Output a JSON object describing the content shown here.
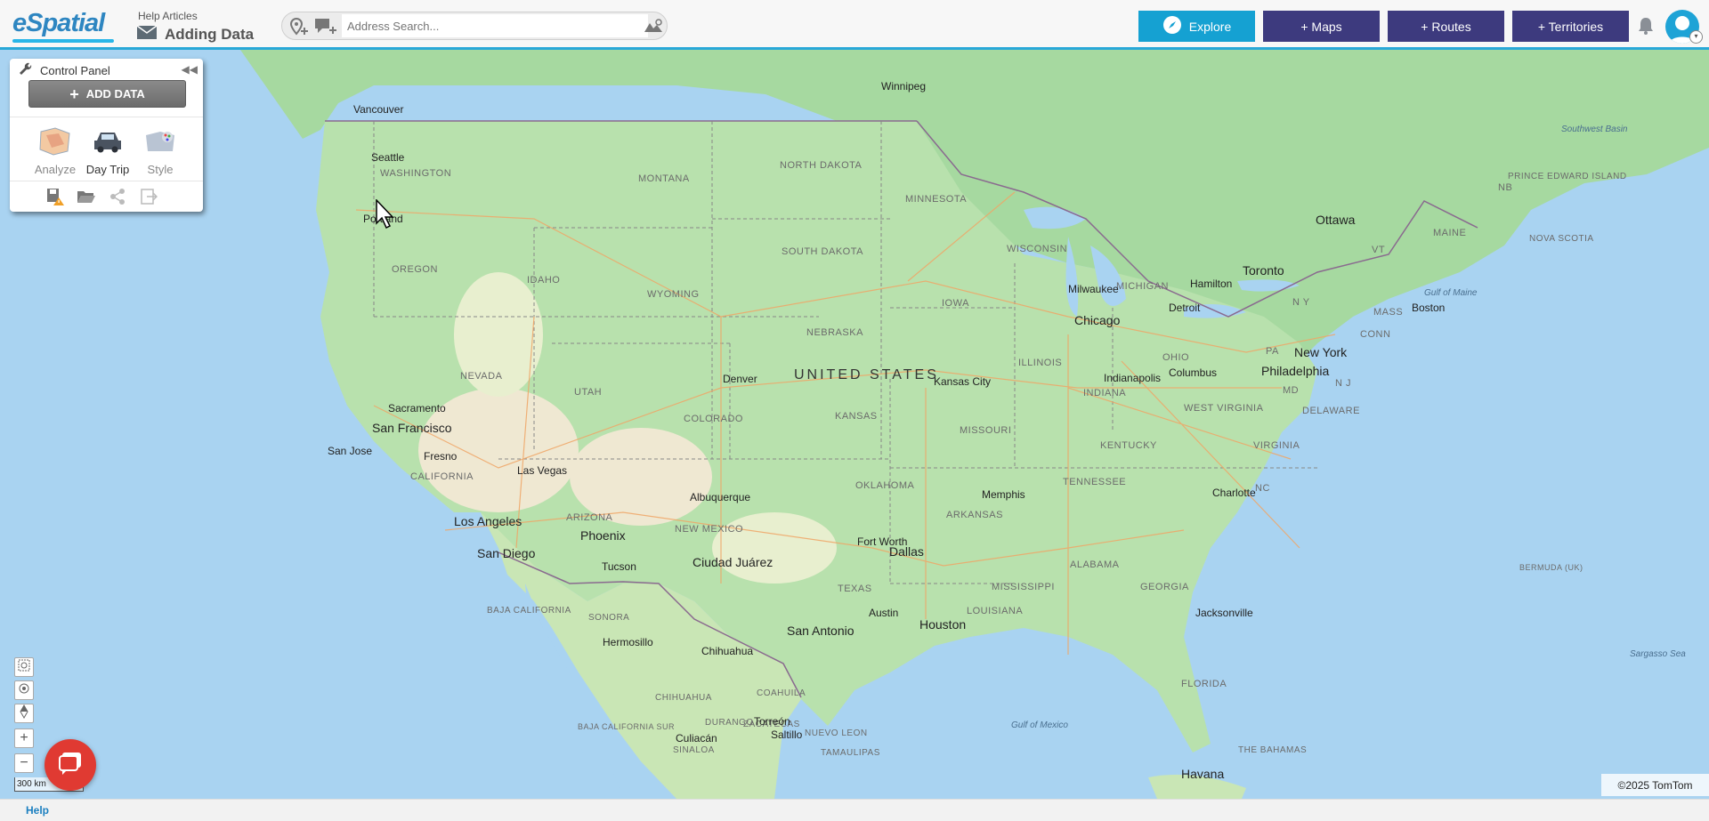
{
  "header": {
    "logo_text": "eSpatial",
    "help_articles_label": "Help Articles",
    "page_title": "Adding Data",
    "search_placeholder": "Address Search...",
    "explore_label": "Explore",
    "maps_label": "+ Maps",
    "routes_label": "+ Routes",
    "territories_label": "+ Territories"
  },
  "control_panel": {
    "title": "Control Panel",
    "add_data_label": "ADD DATA",
    "tools": [
      {
        "label": "Analyze",
        "icon": "analyze-icon"
      },
      {
        "label": "Day Trip",
        "icon": "car-icon"
      },
      {
        "label": "Style",
        "icon": "style-icon"
      }
    ],
    "actions": [
      "save-warning-icon",
      "folder-open-icon",
      "share-icon",
      "export-icon"
    ]
  },
  "map": {
    "country_label": "UNITED STATES",
    "states": [
      "WASHINGTON",
      "OREGON",
      "IDAHO",
      "MONTANA",
      "NORTH DAKOTA",
      "MINNESOTA",
      "SOUTH DAKOTA",
      "WYOMING",
      "NEBRASKA",
      "IOWA",
      "WISCONSIN",
      "MICHIGAN",
      "NEVADA",
      "UTAH",
      "COLORADO",
      "KANSAS",
      "MISSOURI",
      "ILLINOIS",
      "INDIANA",
      "OHIO",
      "CALIFORNIA",
      "ARIZONA",
      "NEW MEXICO",
      "OKLAHOMA",
      "ARKANSAS",
      "TENNESSEE",
      "KENTUCKY",
      "WEST VIRGINIA",
      "VIRGINIA",
      "TEXAS",
      "LOUISIANA",
      "MISSISSIPPI",
      "ALABAMA",
      "GEORGIA",
      "FLORIDA",
      "NC",
      "PA",
      "N Y",
      "MAINE",
      "NB",
      "MASS",
      "CONN",
      "N J",
      "MD",
      "DELAWARE",
      "VT",
      "BAJA CALIFORNIA",
      "SONORA",
      "CHIHUAHUA",
      "COAHUILA",
      "NUEVO LEON",
      "DURANGO",
      "ZACATECAS",
      "TAMAULIPAS",
      "SINALOA",
      "BAJA CALIFORNIA SUR",
      "NOVA SCOTIA",
      "PRINCE EDWARD ISLAND",
      "THE BAHAMAS",
      "BERMUDA (UK)"
    ],
    "cities": [
      "Vancouver",
      "Seattle",
      "Portland",
      "Winnipeg",
      "Sacramento",
      "San Francisco",
      "San Jose",
      "Fresno",
      "Las Vegas",
      "Los Angeles",
      "San Diego",
      "Phoenix",
      "Tucson",
      "Denver",
      "Albuquerque",
      "Ciudad Juárez",
      "Kansas City",
      "Fort Worth",
      "Dallas",
      "Austin",
      "San Antonio",
      "Houston",
      "Hermosillo",
      "Chihuahua",
      "Torreón",
      "Saltillo",
      "Culiacán",
      "Memphis",
      "Chicago",
      "Milwaukee",
      "Indianapolis",
      "Columbus",
      "Detroit",
      "Toronto",
      "Hamilton",
      "Ottawa",
      "Boston",
      "New York",
      "Philadelphia",
      "Charlotte",
      "Jacksonville",
      "Havana"
    ],
    "water_labels": [
      "Southwest Basin",
      "Gulf of Maine",
      "Gulf of Mexico",
      "Sargasso Sea"
    ],
    "copyright": "©2025 TomTom",
    "scale_label": "300 km"
  },
  "footer": {
    "help_label": "Help"
  }
}
